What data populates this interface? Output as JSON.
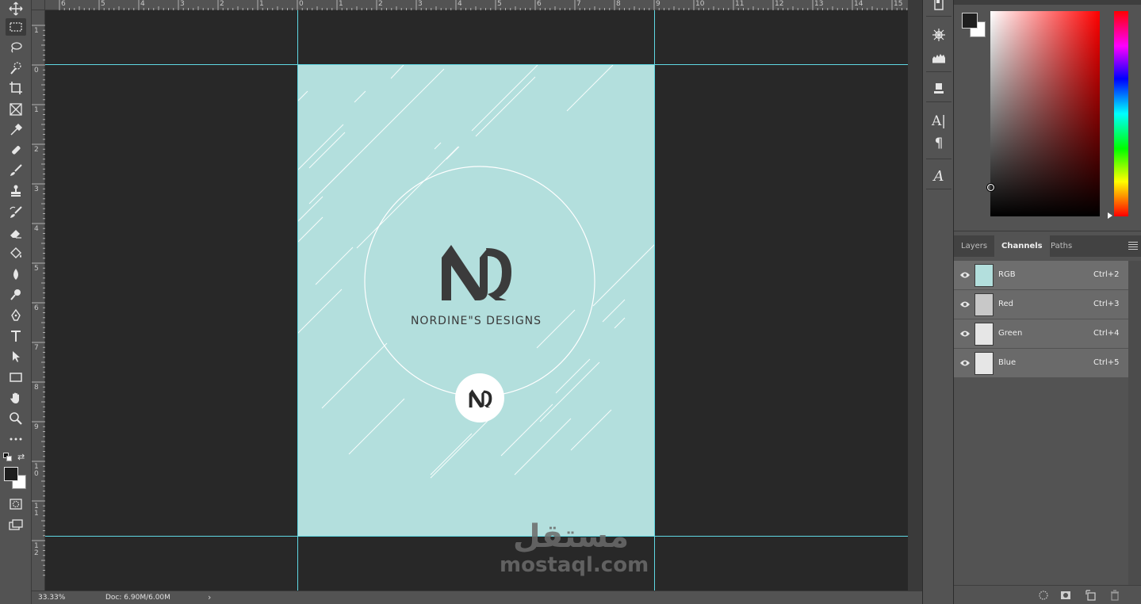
{
  "toolbar": {
    "tools": [
      "move-tool",
      "marquee-tool",
      "lasso-tool",
      "quick-select-tool",
      "crop-tool",
      "frame-tool",
      "eyedropper-tool",
      "healing-brush-tool",
      "brush-tool",
      "clone-stamp-tool",
      "history-brush-tool",
      "eraser-tool",
      "paint-bucket-tool",
      "blur-tool",
      "dodge-tool",
      "pen-tool",
      "type-tool",
      "path-selection-tool",
      "rectangle-tool",
      "hand-tool",
      "zoom-tool",
      "more-tools"
    ],
    "active_tool": "marquee-tool"
  },
  "ruler": {
    "top_labels": [
      "6",
      "5",
      "4",
      "3",
      "2",
      "1",
      "0",
      "1",
      "2",
      "3",
      "4",
      "5",
      "6",
      "7",
      "8",
      "9",
      "10",
      "11",
      "12",
      "13",
      "14",
      "15"
    ],
    "left_labels": [
      "1",
      "0",
      "1",
      "2",
      "3",
      "4",
      "5",
      "6",
      "7",
      "8",
      "9",
      "1 0",
      "1 1",
      "1 2"
    ]
  },
  "canvas": {
    "artboard_color": "#b3dfdd",
    "guide_color": "#5fd8e3",
    "brand_name": "NORDINE\"S DESIGNS"
  },
  "watermark": {
    "arabic": "مستقل",
    "latin": "mostaql.com"
  },
  "statusbar": {
    "zoom": "33.33%",
    "doc": "Doc: 6.90M/6.00M",
    "arrow": "›"
  },
  "icon_panel": [
    "properties-icon",
    "adjustments-icon",
    "histogram-icon",
    "3d-icon",
    "character-icon",
    "paragraph-icon",
    "glyphs-icon"
  ],
  "color_panel": {
    "foreground": "#1e1e1e",
    "background": "#ffffff"
  },
  "panel_tabs": [
    {
      "label": "Layers",
      "active": false
    },
    {
      "label": "Channels",
      "active": true
    },
    {
      "label": "Paths",
      "active": false
    }
  ],
  "channels": [
    {
      "name": "RGB",
      "shortcut": "Ctrl+2"
    },
    {
      "name": "Red",
      "shortcut": "Ctrl+3"
    },
    {
      "name": "Green",
      "shortcut": "Ctrl+4"
    },
    {
      "name": "Blue",
      "shortcut": "Ctrl+5"
    }
  ]
}
